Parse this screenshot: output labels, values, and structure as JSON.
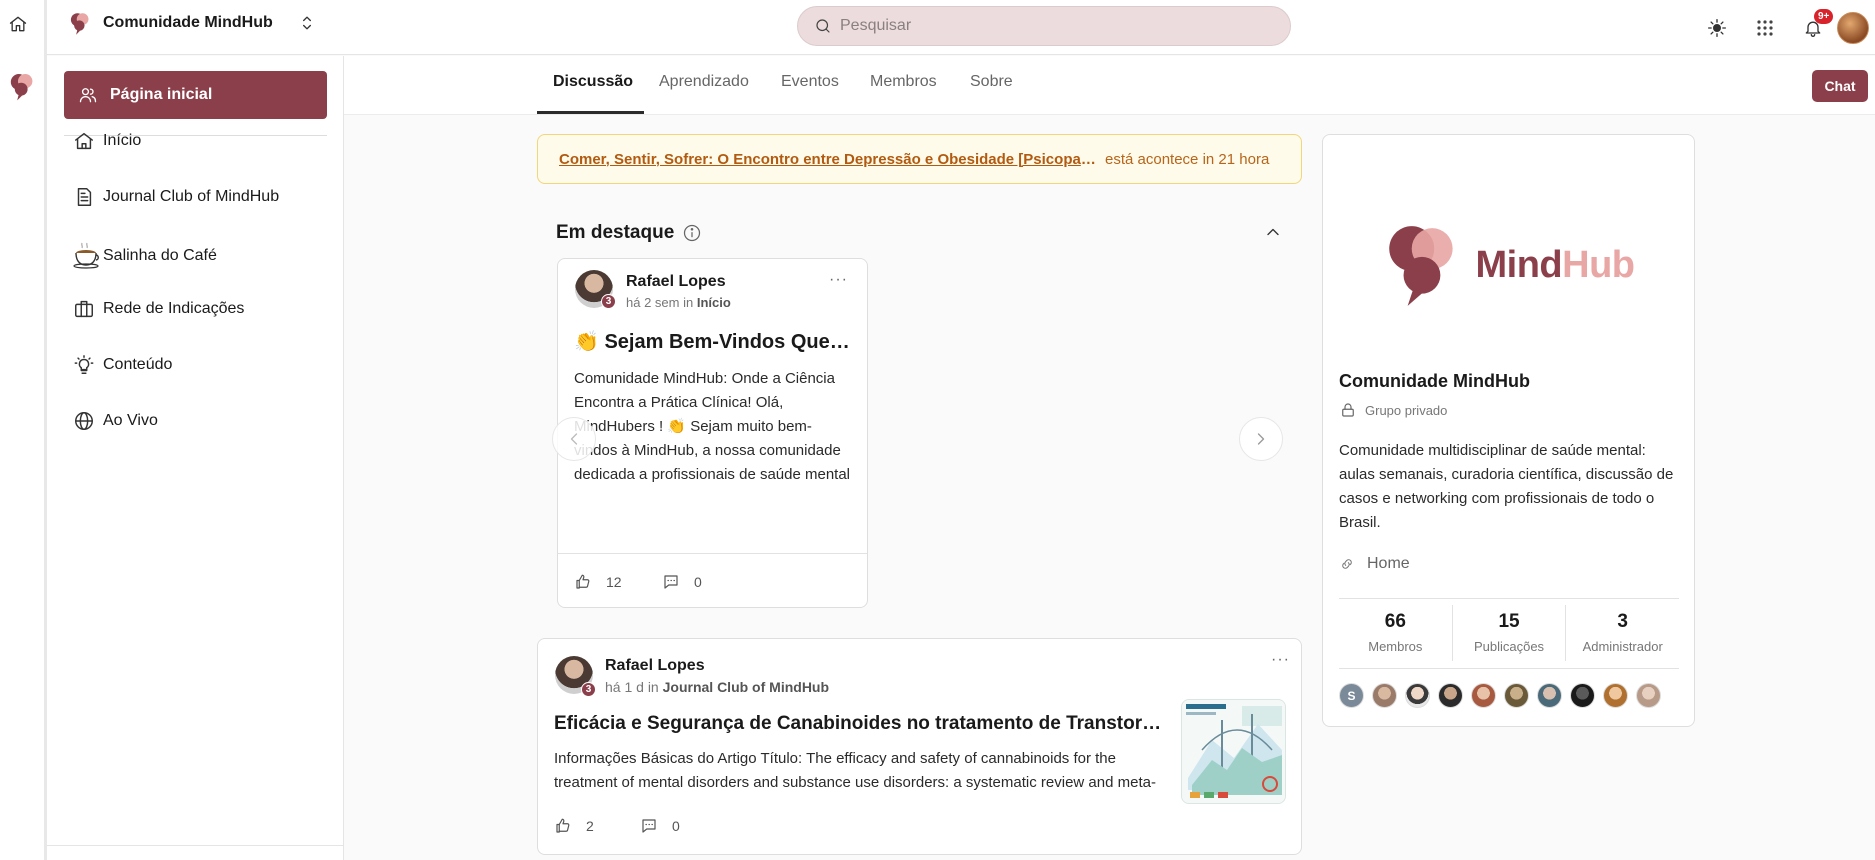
{
  "topbar": {
    "community_name": "Comunidade MindHub",
    "search_placeholder": "Pesquisar",
    "notifications_badge": "9+"
  },
  "sidebar": {
    "home_page_label": "Página inicial",
    "items": [
      {
        "label": "Início",
        "icon": "house-icon"
      },
      {
        "label": "Journal Club of MindHub",
        "icon": "document-icon"
      },
      {
        "label": "Salinha do Café",
        "icon": "coffee-icon"
      },
      {
        "label": "Rede de Indicações",
        "icon": "briefcase-icon"
      },
      {
        "label": "Conteúdo",
        "icon": "lightbulb-icon"
      },
      {
        "label": "Ao Vivo",
        "icon": "globe-icon"
      }
    ]
  },
  "tabs": [
    {
      "label": "Discussão",
      "active": true
    },
    {
      "label": "Aprendizado",
      "active": false
    },
    {
      "label": "Eventos",
      "active": false
    },
    {
      "label": "Membros",
      "active": false
    },
    {
      "label": "Sobre",
      "active": false
    }
  ],
  "chat_label": "Chat",
  "event": {
    "title": "Comer, Sentir, Sofrer: O Encontro entre Depressão e Obesidade [Psicopato...",
    "status": "está acontece in 21 hora"
  },
  "featured": {
    "title": "Em destaque",
    "card": {
      "author": "Rafael Lopes",
      "level": "3",
      "time": "há 2 sem in",
      "space": "Início",
      "title": "👏 Sejam Bem-Vindos Queri...",
      "body": "Comunidade MindHub: Onde a Ciência Encontra a Prática Clínica! Olá, MindHubers ! 👏 Sejam muito bem-vindos à MindHub, a nossa comunidade dedicada a profissionais de saúde mental que levam a sério a atualização constante, a prática",
      "likes": "12",
      "comments": "0"
    }
  },
  "post": {
    "author": "Rafael Lopes",
    "level": "3",
    "time": "há 1 d in",
    "space": "Journal Club of MindHub",
    "title": "Eficácia e Segurança de Canabinoides no tratamento de Transtornos Mentais",
    "body": "Informações Básicas do Artigo Título: The efficacy and safety of cannabinoids for the treatment of mental disorders and substance use disorders: a systematic review and meta-analysis",
    "likes": "2",
    "comments": "0"
  },
  "about": {
    "brand_mind": "Mind",
    "brand_hub": "Hub",
    "name": "Comunidade MindHub",
    "privacy": "Grupo privado",
    "description": "Comunidade multidisciplinar de saúde mental: aulas semanais, curadoria científica, discussão de casos e networking com profissionais de todo o Brasil.",
    "link_label": "Home",
    "stats": [
      {
        "value": "66",
        "label": "Membros"
      },
      {
        "value": "15",
        "label": "Publicações"
      },
      {
        "value": "3",
        "label": "Administrador"
      }
    ],
    "member_initial": "S"
  },
  "colors": {
    "brand": "#8b3f4a",
    "brand_light": "#e8a6a4",
    "event_bg": "#fffbea",
    "event_link": "#b15a10"
  }
}
